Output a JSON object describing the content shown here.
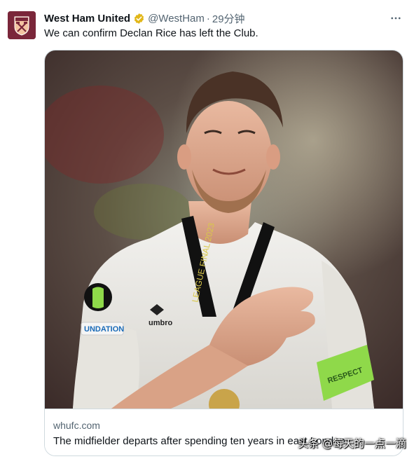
{
  "tweet": {
    "author_name": "West Ham United",
    "handle": "@WestHam",
    "separator": "·",
    "time": "29分钟",
    "text": "We can confirm Declan Rice has left the Club.",
    "verified": true,
    "icons": {
      "avatar": "west-ham-crest",
      "verified": "gold-verified-badge",
      "more": "more-options-dots"
    }
  },
  "card": {
    "domain": "whufc.com",
    "headline": "The midfielder departs after spending ten years in east London",
    "image_description_icon": "player-photo",
    "medal_text": "LEAGUE FINAL 2023",
    "shirt_brand": "umbro",
    "captain_armband": "RESPECT"
  },
  "watermark": {
    "text": "头条 @每天的一点一滴"
  },
  "colors": {
    "brand_claret": "#7a263a",
    "verified_gold": "#e2b719",
    "armband_green": "#8fd94a"
  }
}
